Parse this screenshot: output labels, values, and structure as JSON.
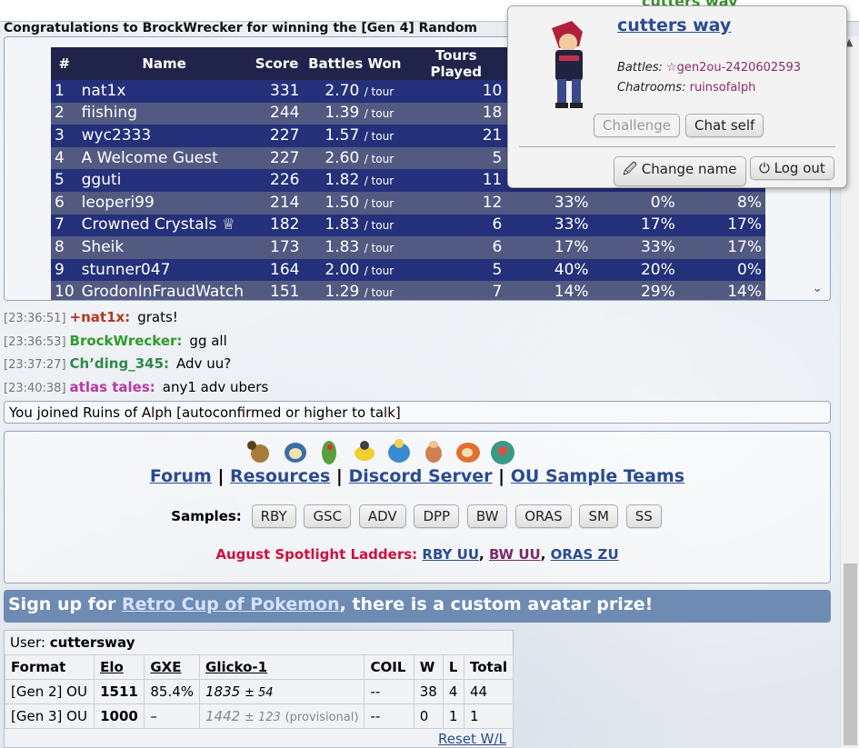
{
  "topbar": {
    "username": "cutters way"
  },
  "announcement": "Congratulations to BrockWrecker for winning the [Gen 4] Random",
  "tour_table": {
    "headers": [
      "#",
      "Name",
      "Score",
      "Battles Won",
      "Tours Played"
    ],
    "bw_unit": "/ tour",
    "rows": [
      {
        "rank": "1",
        "name": "nat1x",
        "score": "331",
        "bw": "2.70",
        "tp": "10",
        "p1": "",
        "p2": "",
        "p3": ""
      },
      {
        "rank": "2",
        "name": "fiishing",
        "score": "244",
        "bw": "1.39",
        "tp": "18",
        "p1": "",
        "p2": "",
        "p3": ""
      },
      {
        "rank": "3",
        "name": "wyc2333",
        "score": "227",
        "bw": "1.57",
        "tp": "21",
        "p1": "",
        "p2": "",
        "p3": ""
      },
      {
        "rank": "4",
        "name": "A Welcome Guest",
        "score": "227",
        "bw": "2.60",
        "tp": "5",
        "p1": "",
        "p2": "",
        "p3": ""
      },
      {
        "rank": "5",
        "name": "gguti",
        "score": "226",
        "bw": "1.82",
        "tp": "11",
        "p1": "",
        "p2": "",
        "p3": ""
      },
      {
        "rank": "6",
        "name": "leoperi99",
        "score": "214",
        "bw": "1.50",
        "tp": "12",
        "p1": "33%",
        "p2": "0%",
        "p3": "8%"
      },
      {
        "rank": "7",
        "name": "Crowned Crystals ♕",
        "score": "182",
        "bw": "1.83",
        "tp": "6",
        "p1": "33%",
        "p2": "17%",
        "p3": "17%"
      },
      {
        "rank": "8",
        "name": "Sheik",
        "score": "173",
        "bw": "1.83",
        "tp": "6",
        "p1": "17%",
        "p2": "33%",
        "p3": "17%"
      },
      {
        "rank": "9",
        "name": "stunner047",
        "score": "164",
        "bw": "2.00",
        "tp": "5",
        "p1": "40%",
        "p2": "20%",
        "p3": "0%"
      },
      {
        "rank": "10",
        "name": "GrodonInFraudWatch",
        "score": "151",
        "bw": "1.29",
        "tp": "7",
        "p1": "14%",
        "p2": "29%",
        "p3": "14%"
      }
    ]
  },
  "chat": [
    {
      "time": "[23:36:51]",
      "user": "+nat1x:",
      "color": "#b5371d",
      "msg": "grats!"
    },
    {
      "time": "[23:36:53]",
      "user": "BrockWrecker:",
      "color": "#2e9b2e",
      "msg": "gg all"
    },
    {
      "time": "[23:37:27]",
      "user": "Ch’ding_345:",
      "color": "#2e8a4a",
      "msg": "Adv uu?"
    },
    {
      "time": "[23:40:38]",
      "user": "atlas tales:",
      "color": "#b83b9e",
      "msg": "any1 adv ubers"
    }
  ],
  "joined_notice": "You joined Ruins of Alph [autoconfirmed or higher to talk]",
  "room_intro": {
    "links": [
      "Forum",
      "Resources",
      "Discord Server",
      "OU Sample Teams"
    ],
    "separator": "|",
    "samples_label": "Samples:",
    "samples": [
      "RBY",
      "GSC",
      "ADV",
      "DPP",
      "BW",
      "ORAS",
      "SM",
      "SS"
    ],
    "spotlight_label": "August Spotlight Ladders:",
    "spotlight_links": [
      {
        "text": "RBY UU",
        "color": "#2a4c8f"
      },
      {
        "text": "BW UU",
        "color": "#7a2a6a"
      },
      {
        "text": "ORAS ZU",
        "color": "#2a4c8f"
      }
    ],
    "comma": ","
  },
  "signup": {
    "prefix": "Sign up for ",
    "link": "Retro Cup of Pokemon",
    "suffix": ", there is a custom avatar prize!"
  },
  "user_stats": {
    "user_label": "User:",
    "username": "cuttersway",
    "headers": [
      "Format",
      "Elo",
      "GXE",
      "Glicko-1",
      "COIL",
      "W",
      "L",
      "Total"
    ],
    "rows": [
      {
        "format": "[Gen 2] OU",
        "elo": "1511",
        "gxe": "85.4%",
        "glicko": "1835",
        "dev": "± 54",
        "prov": "",
        "coil": "--",
        "w": "38",
        "l": "4",
        "total": "44"
      },
      {
        "format": "[Gen 3] OU",
        "elo": "1000",
        "gxe": "–",
        "glicko": "1442",
        "dev": "± 123",
        "prov": "(provisional)",
        "coil": "--",
        "w": "0",
        "l": "1",
        "total": "1"
      }
    ],
    "reset_label": "Reset W/L"
  },
  "popup": {
    "name": "cutters way",
    "battles_label": "Battles:",
    "battles_value": "☆gen2ou-2420602593",
    "chatrooms_label": "Chatrooms:",
    "chatrooms_value": "ruinsofalph",
    "challenge_label": "Challenge",
    "chatself_label": "Chat self",
    "changename_label": "Change name",
    "logout_label": "Log out",
    "pencil_glyph": "🖉",
    "power_glyph": "⏻"
  },
  "icons": {
    "chevron": "⌄",
    "scroll_up": "▲"
  }
}
